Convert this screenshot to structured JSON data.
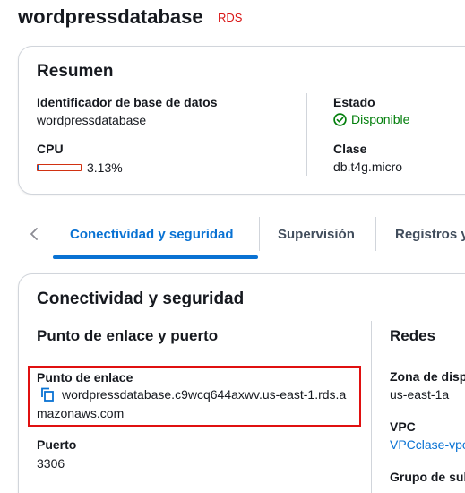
{
  "header": {
    "title": "wordpressdatabase",
    "badge": "RDS"
  },
  "summary": {
    "title": "Resumen",
    "identifier_label": "Identificador de base de datos",
    "identifier_value": "wordpressdatabase",
    "cpu_label": "CPU",
    "cpu_value": "3.13%",
    "cpu_fraction": 0.0313,
    "status_label": "Estado",
    "status_value": "Disponible",
    "class_label": "Clase",
    "class_value": "db.t4g.micro"
  },
  "tabs": [
    {
      "label": "Conectividad y seguridad",
      "active": true
    },
    {
      "label": "Supervisión",
      "active": false
    },
    {
      "label": "Registros y",
      "active": false
    }
  ],
  "connectivity": {
    "title": "Conectividad y seguridad",
    "endpoint_section_title": "Punto de enlace y puerto",
    "endpoint_label": "Punto de enlace",
    "endpoint_line1": "wordpressdatabase.c9wcq644axwv.us-east-1.rds.a",
    "endpoint_line2": "mazonaws.com",
    "port_label": "Puerto",
    "port_value": "3306",
    "network_title": "Redes",
    "az_label": "Zona de disp",
    "az_value": "us-east-1a",
    "vpc_label": "VPC",
    "vpc_value": "VPCclase-vpc",
    "subnet_label": "Grupo de sub"
  },
  "colors": {
    "accent": "#0972d3",
    "success": "#037f0c",
    "badge": "#d91515",
    "highlight": "#e01010"
  }
}
